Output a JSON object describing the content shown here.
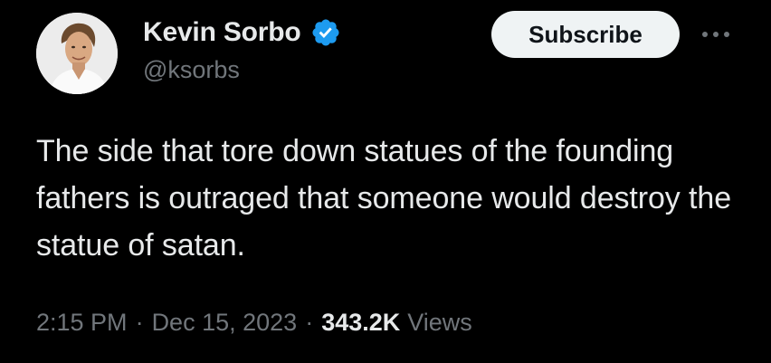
{
  "author": {
    "display_name": "Kevin Sorbo",
    "handle": "@ksorbs",
    "verified": true,
    "verified_color": "#1d9bf0"
  },
  "actions": {
    "subscribe_label": "Subscribe"
  },
  "tweet": {
    "text": "The side that tore down statues of the founding fathers is outraged that someone would destroy the statue of satan.",
    "time": "2:15 PM",
    "date": "Dec 15, 2023",
    "separator": "·",
    "views_count": "343.2K",
    "views_label": "Views"
  },
  "icons": {
    "verified": "verified-badge-icon",
    "more": "more-horizontal-icon"
  },
  "colors": {
    "background": "#000000",
    "primary_text": "#e7e9ea",
    "secondary_text": "#71767b",
    "button_bg": "#eff3f4"
  }
}
